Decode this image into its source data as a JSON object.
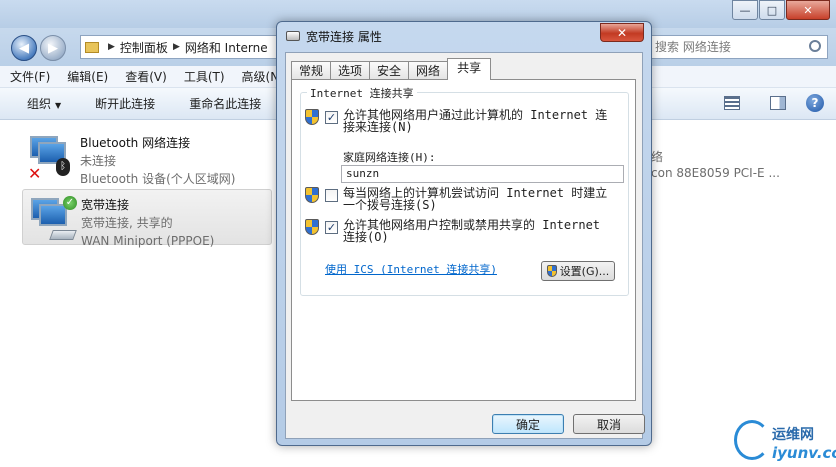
{
  "explorer": {
    "breadcrumb": [
      "控制面板",
      "网络和 Interne"
    ],
    "search_placeholder": "搜索 网络连接",
    "menu": [
      "文件(F)",
      "编辑(E)",
      "查看(V)",
      "工具(T)",
      "高级(N)"
    ],
    "commands": [
      "组织",
      "断开此连接",
      "重命名此连接"
    ],
    "connections": [
      {
        "name": "Bluetooth 网络连接",
        "status": "未连接",
        "device": "Bluetooth 设备(个人区域网)"
      },
      {
        "name": "宽带连接",
        "status": "宽带连接, 共享的",
        "device": "WAN Miniport (PPPOE)"
      }
    ],
    "right_partial_1": "络",
    "right_partial_2": "con 88E8059 PCI-E ..."
  },
  "dialog": {
    "title": "宽带连接 属性",
    "close_label": "✕",
    "tabs": [
      "常规",
      "选项",
      "安全",
      "网络",
      "共享"
    ],
    "active_tab": "共享",
    "group_title": "Internet 连接共享",
    "option1": {
      "text": "允许其他网络用户通过此计算机的 Internet 连接来连接(N)",
      "checked": true
    },
    "home_label": "家庭网络连接(H):",
    "home_value": "sunzn",
    "option2": {
      "text": "每当网络上的计算机尝试访问 Internet 时建立一个拨号连接(S)",
      "checked": false
    },
    "option3": {
      "text": "允许其他网络用户控制或禁用共享的 Internet 连接(O)",
      "checked": true
    },
    "ics_link": "使用 ICS (Internet 连接共享)",
    "settings_button": "设置(G)...",
    "ok_button": "确定",
    "cancel_button": "取消"
  },
  "watermark": {
    "cn": "运维网",
    "en": "iyunv.com"
  }
}
